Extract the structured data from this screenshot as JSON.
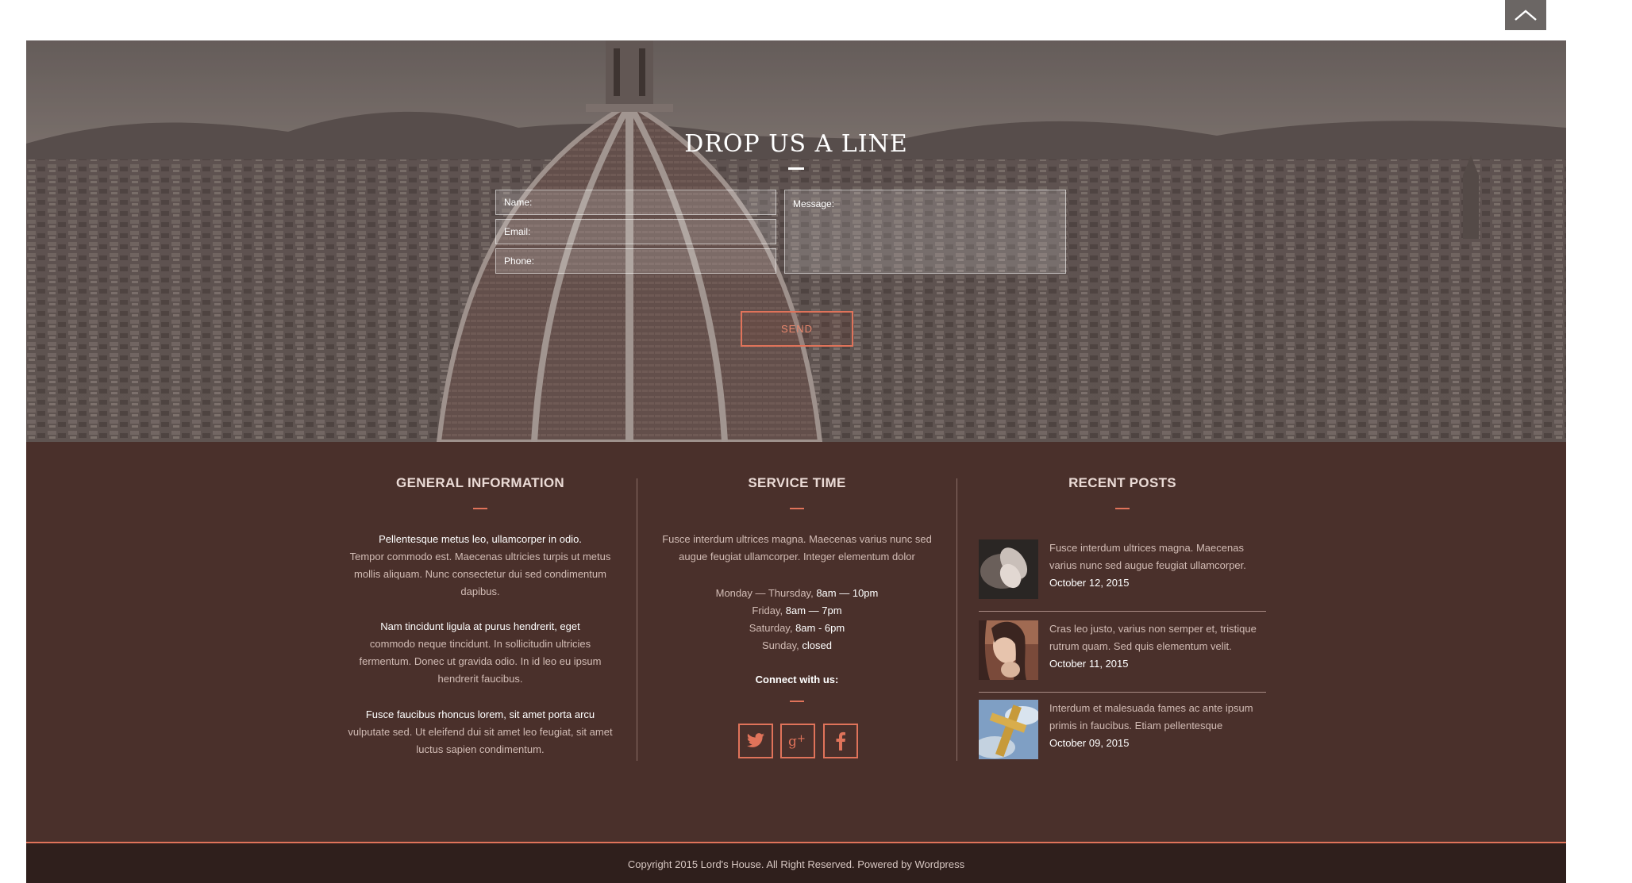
{
  "scroll_top": {
    "icon": "chevron-up-icon"
  },
  "contact": {
    "title": "DROP US A LINE",
    "name_placeholder": "Name:",
    "email_placeholder": "Email:",
    "phone_placeholder": "Phone:",
    "message_placeholder": "Message:",
    "send_label": "SEND"
  },
  "general_info": {
    "title": "GENERAL INFORMATION",
    "paragraphs": [
      {
        "head": "Pellentesque metus leo, ullamcorper in odio.",
        "body": "Tempor commodo est. Maecenas ultricies turpis ut metus mollis aliquam. Nunc consectetur dui sed condimentum dapibus."
      },
      {
        "head": "Nam tincidunt ligula at purus hendrerit, eget",
        "body": "commodo neque tincidunt. In sollicitudin ultricies fermentum.  Donec ut gravida odio. In id leo eu ipsum hendrerit faucibus."
      },
      {
        "head": "Fusce faucibus rhoncus lorem, sit amet porta arcu",
        "body": "vulputate sed. Ut eleifend dui sit amet leo feugiat, sit amet luctus sapien condimentum."
      }
    ]
  },
  "service_time": {
    "title": "SERVICE TIME",
    "intro": "Fusce interdum ultrices magna. Maecenas varius nunc sed augue feugiat ullamcorper. Integer elementum dolor",
    "schedule": [
      {
        "day": "Monday — Thursday,",
        "time": "8am — 10pm"
      },
      {
        "day": "Friday,",
        "time": "8am — 7pm"
      },
      {
        "day": "Saturday,",
        "time": "8am - 6pm"
      },
      {
        "day": "Sunday,",
        "time": "closed"
      }
    ],
    "connect_label": "Connect with us:",
    "social": [
      {
        "name": "twitter-icon"
      },
      {
        "name": "google-plus-icon"
      },
      {
        "name": "facebook-icon"
      }
    ]
  },
  "recent_posts": {
    "title": "RECENT POSTS",
    "posts": [
      {
        "text": "Fusce interdum ultrices magna. Maecenas varius nunc sed augue feugiat ullamcorper.",
        "date": "October 12, 2015"
      },
      {
        "text": "Cras leo justo, varius non semper et, tristique rutrum quam. Sed quis elementum velit.",
        "date": "October 11, 2015"
      },
      {
        "text": "Interdum et malesuada fames ac ante ipsum primis in faucibus. Etiam pellentesque",
        "date": "October 09, 2015"
      }
    ]
  },
  "footer": {
    "copyright": "Copyright 2015 Lord's House. All Right Reserved. Powered by Wordpress"
  },
  "colors": {
    "accent": "#e0735a",
    "footer_bg": "#4a302b",
    "copyright_bg": "#2f1f1c"
  }
}
